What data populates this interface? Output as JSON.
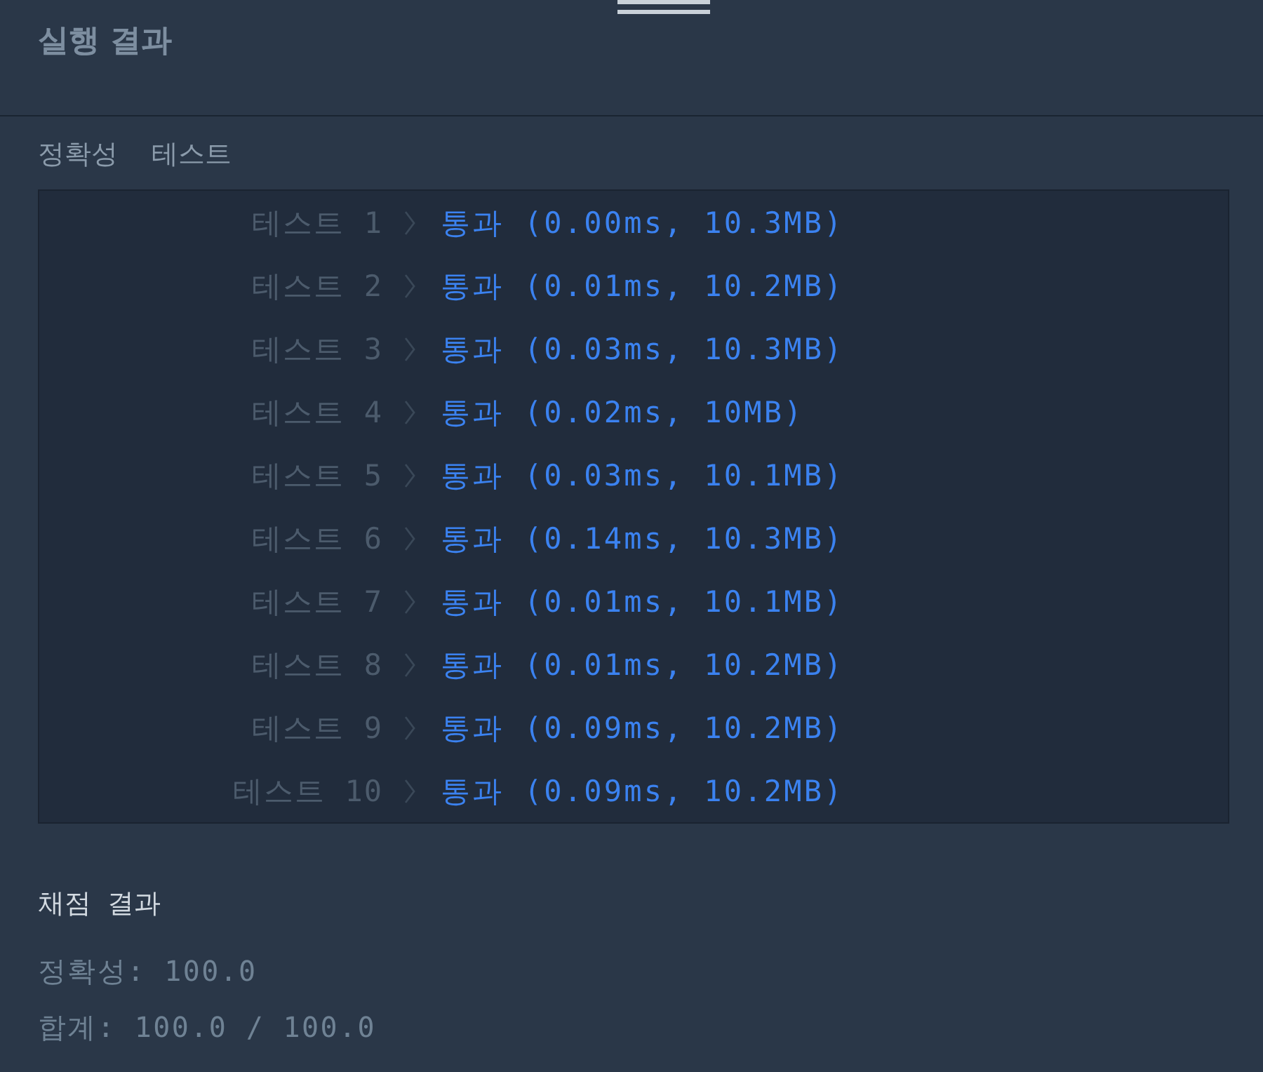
{
  "header": {
    "title": "실행 결과"
  },
  "accuracy_test": {
    "title": "정확성 테스트",
    "rows": [
      {
        "label": "테스트 1",
        "result": "통과 (0.00ms, 10.3MB)",
        "passed": true
      },
      {
        "label": "테스트 2",
        "result": "통과 (0.01ms, 10.2MB)",
        "passed": true
      },
      {
        "label": "테스트 3",
        "result": "통과 (0.03ms, 10.3MB)",
        "passed": true
      },
      {
        "label": "테스트 4",
        "result": "통과 (0.02ms, 10MB)",
        "passed": true
      },
      {
        "label": "테스트 5",
        "result": "통과 (0.03ms, 10.1MB)",
        "passed": true
      },
      {
        "label": "테스트 6",
        "result": "통과 (0.14ms, 10.3MB)",
        "passed": true
      },
      {
        "label": "테스트 7",
        "result": "통과 (0.01ms, 10.1MB)",
        "passed": true
      },
      {
        "label": "테스트 8",
        "result": "통과 (0.01ms, 10.2MB)",
        "passed": true
      },
      {
        "label": "테스트 9",
        "result": "통과 (0.09ms, 10.2MB)",
        "passed": true
      },
      {
        "label": "테스트 10",
        "result": "통과 (0.09ms, 10.2MB)",
        "passed": true
      }
    ]
  },
  "grading": {
    "title": "채점 결과",
    "lines": [
      "정확성: 100.0",
      "합계: 100.0 / 100.0"
    ]
  }
}
